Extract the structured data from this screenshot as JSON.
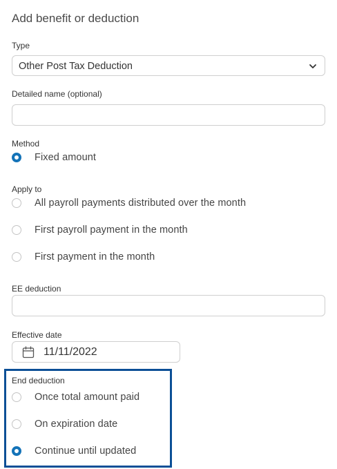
{
  "form": {
    "title": "Add benefit or deduction",
    "type_label": "Type",
    "type_value": "Other Post Tax Deduction",
    "detailed_name_label": "Detailed name (optional)",
    "detailed_name_value": "",
    "method_label": "Method",
    "method_options": [
      {
        "label": "Fixed amount",
        "selected": true
      }
    ],
    "apply_to_label": "Apply to",
    "apply_to_options": [
      {
        "label": "All payroll payments distributed over the month",
        "selected": false
      },
      {
        "label": "First payroll payment in the month",
        "selected": false
      },
      {
        "label": "First payment in the month",
        "selected": false
      }
    ],
    "ee_deduction_label": "EE deduction",
    "ee_deduction_value": "",
    "effective_date_label": "Effective date",
    "effective_date_value": "11/11/2022",
    "end_deduction_label": "End deduction",
    "end_deduction_options": [
      {
        "label": "Once total amount paid",
        "selected": false
      },
      {
        "label": "On expiration date",
        "selected": false
      },
      {
        "label": "Continue until updated",
        "selected": true
      }
    ]
  },
  "colors": {
    "accent": "#1473b8",
    "highlight_border": "#0b4f96"
  },
  "icons": [
    "chevron-down-icon",
    "calendar-icon"
  ]
}
